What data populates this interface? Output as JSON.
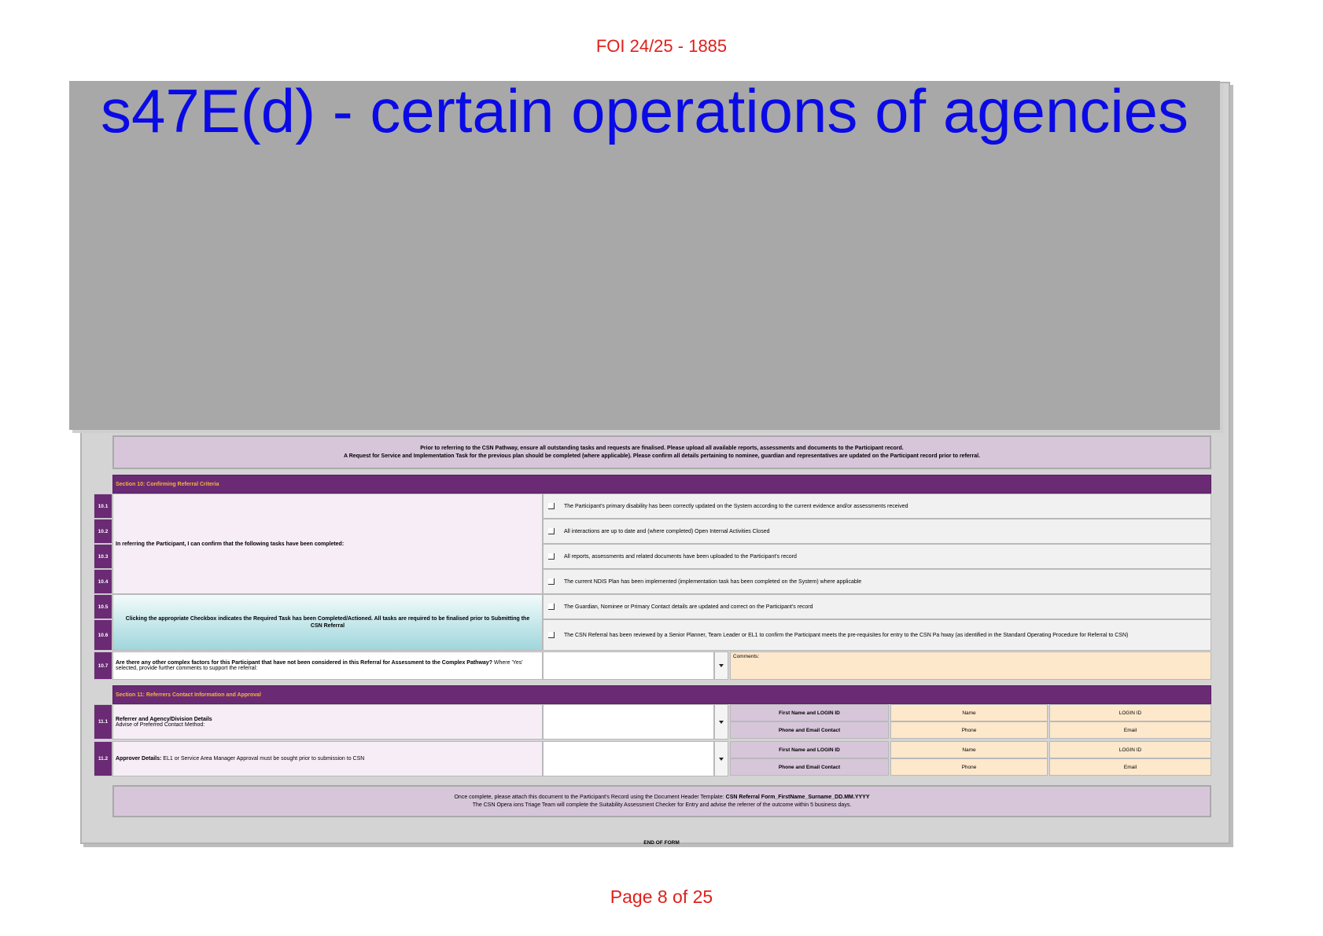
{
  "header": {
    "foi_ref": "FOI 24/25 - 1885"
  },
  "redaction": {
    "label": "s47E(d) - certain operations of agencies"
  },
  "intro_notice": {
    "line1": "Prior to referring to the CSN Pathway, ensure all outstanding tasks and requests are finalised.  Please upload all available reports, assessments and documents to the Participant record.",
    "line2": "A Request for Service and Implementation Task for the previous plan should be completed (where applicable).  Please confirm all details pertaining to nominee, guardian and representatives are updated on the Participant record prior to referral."
  },
  "section10": {
    "title": "Section 10: Confirming Referral Criteria",
    "intro_label": "In referring the Participant, I can confirm that the following tasks have been completed:",
    "instruction": "Clicking the appropriate Checkbox indicates the Required Task has been Completed/Actioned. All tasks are required to be finalised prior to Submitting the CSN Referral",
    "rows": [
      {
        "num": "10.1",
        "text": "The Participant's primary disability has been correctly updated on the System according to the current evidence and/or assessments received"
      },
      {
        "num": "10.2",
        "text": "All interactions are up to date and (where completed) Open Internal Activities Closed"
      },
      {
        "num": "10.3",
        "text": "All reports, assessments and related documents have been uploaded to the Participant's record"
      },
      {
        "num": "10.4",
        "text": "The current NDIS Plan has been implemented (implementation task has been completed on the System) where applicable"
      },
      {
        "num": "10.5",
        "text": "The Guardian, Nominee or Primary Contact details are updated and correct on the Participant's record"
      },
      {
        "num": "10.6",
        "text": "The CSN Referral has been reviewed by a Senior Planner, Team Leader or EL1 to confirm the Participant meets the pre-requisites for entry to the CSN Pa hway (as identified in the Standard Operating Procedure for Referral to CSN)"
      }
    ],
    "q107": {
      "num": "10.7",
      "question_bold": "Are there any other complex factors for this Participant that have not been considered in this Referral for Assessment to the Complex Pathway?",
      "question_rest": " Where 'Yes' selected, provide further comments to support the referral:",
      "comments_label": "Comments:"
    }
  },
  "section11": {
    "title": "Section 11: Referrers Contact Information and Approval",
    "r111": {
      "num": "11.1",
      "label_bold": "Referrer and Agency/Division Details",
      "label_rest": "Advise of Preferred Contact Method:",
      "first_name_login": "First Name and LOGIN ID",
      "phone_email": "Phone and Email Contact",
      "name": "Name",
      "login_id": "LOGIN ID",
      "phone": "Phone",
      "email": "Email"
    },
    "r112": {
      "num": "11.2",
      "label_bold": "Approver Details:",
      "label_rest": "  EL1 or Service Area Manager Approval must be sought prior to submission to CSN",
      "first_name_login": "First Name and LOGIN ID",
      "phone_email": "Phone and Email Contact",
      "name": "Name",
      "login_id": "LOGIN ID",
      "phone": "Phone",
      "email": "Email"
    }
  },
  "closing_notice": {
    "line1_start": "Once complete, please attach this document to the Participant's Record using the Document Header Template: ",
    "line1_bold": "CSN Referral Form_FirstName_Surname_DD.MM.YYYY",
    "line2": "The CSN Opera ions Triage Team will complete the Suitability Assessment Checker for Entry and advise the referrer of the outcome within 5 business days."
  },
  "end_of_form": "END OF FORM",
  "footer": {
    "page": "Page 8 of 25"
  },
  "colors": {
    "accent_purple": "#6a2a74",
    "section_title": "#f6b33b",
    "stamp_red": "#e0201b",
    "redaction_text": "#0a0ae6"
  }
}
